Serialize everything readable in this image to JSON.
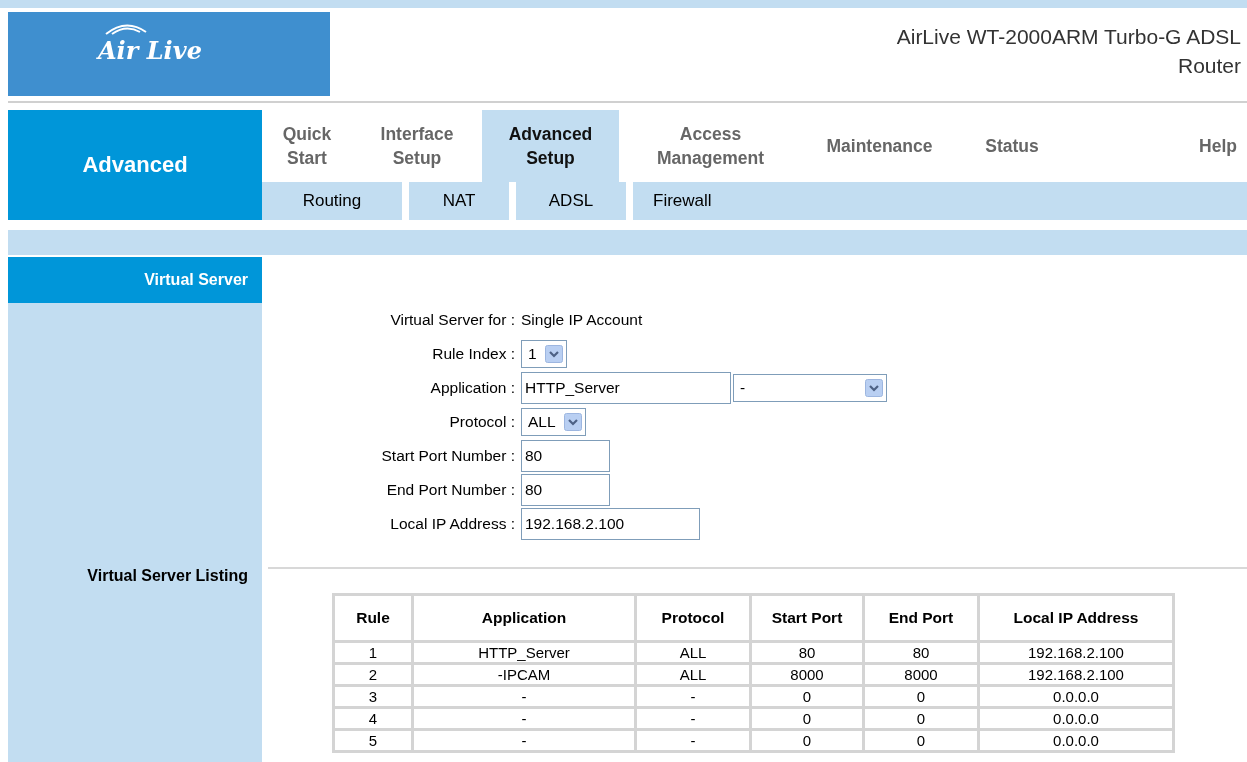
{
  "header": {
    "logo": "Air Live",
    "title": "AirLive WT-2000ARM Turbo-G ADSL Router"
  },
  "section": "Advanced",
  "tabs": [
    {
      "label": "Quick Start",
      "selected": false
    },
    {
      "label": "Interface Setup",
      "selected": false
    },
    {
      "label": "Advanced Setup",
      "selected": true
    },
    {
      "label": "Access Management",
      "selected": false
    },
    {
      "label": "Maintenance",
      "selected": false
    },
    {
      "label": "Status",
      "selected": false
    },
    {
      "label": "Help",
      "selected": false
    }
  ],
  "subtabs": [
    {
      "label": "Routing",
      "selected": false
    },
    {
      "label": "NAT",
      "selected": false
    },
    {
      "label": "ADSL",
      "selected": false
    },
    {
      "label": "Firewall",
      "selected": false
    }
  ],
  "sidebar": {
    "items": [
      {
        "label": "Virtual Server",
        "selected": true
      },
      {
        "label": "Virtual Server Listing",
        "selected": false
      }
    ]
  },
  "form": [
    {
      "kind": "text",
      "label": "Virtual Server for :",
      "value": "Single IP Account"
    },
    {
      "kind": "select",
      "label": "Rule Index :",
      "value": "1"
    },
    {
      "kind": "combo",
      "label": "Application :",
      "value": "HTTP_Server",
      "option": "-"
    },
    {
      "kind": "select",
      "label": "Protocol :",
      "value": "ALL"
    },
    {
      "kind": "short-input",
      "label": "Start Port Number :",
      "value": "80"
    },
    {
      "kind": "short-input",
      "label": "End Port Number :",
      "value": "80"
    },
    {
      "kind": "long-input",
      "label": "Local IP Address :",
      "value": "192.168.2.100"
    }
  ],
  "table": {
    "columns": [
      "Rule",
      "Application",
      "Protocol",
      "Start Port",
      "End Port",
      "Local IP Address"
    ],
    "rows": [
      [
        "1",
        "HTTP_Server",
        "ALL",
        "80",
        "80",
        "192.168.2.100"
      ],
      [
        "2",
        "-IPCAM",
        "ALL",
        "8000",
        "8000",
        "192.168.2.100"
      ],
      [
        "3",
        "-",
        "-",
        "0",
        "0",
        "0.0.0.0"
      ],
      [
        "4",
        "-",
        "-",
        "0",
        "0",
        "0.0.0.0"
      ],
      [
        "5",
        "-",
        "-",
        "0",
        "0",
        "0.0.0.0"
      ]
    ]
  }
}
